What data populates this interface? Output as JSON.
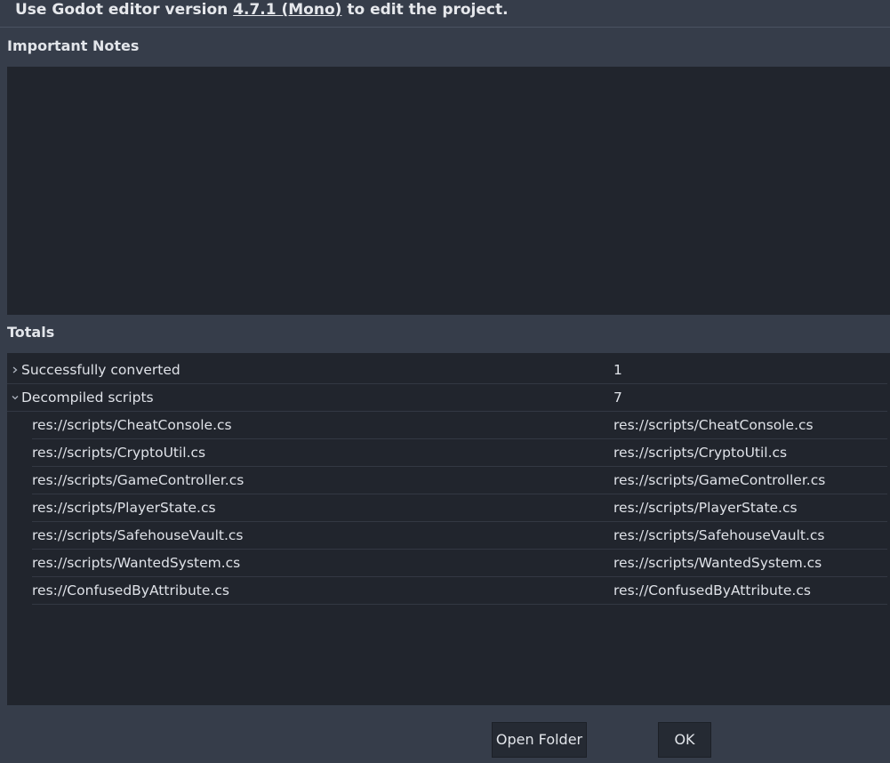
{
  "header": {
    "prefix": "Use Godot editor version ",
    "version": "4.7.1 (Mono)",
    "suffix": " to edit the project."
  },
  "notes": {
    "title": "Important Notes"
  },
  "totals": {
    "title": "Totals",
    "groups": [
      {
        "name": "Successfully converted",
        "value": "1",
        "expanded": false
      },
      {
        "name": "Decompiled scripts",
        "value": "7",
        "expanded": true
      }
    ],
    "scripts": [
      {
        "name": "res://scripts/CheatConsole.cs",
        "value": "res://scripts/CheatConsole.cs"
      },
      {
        "name": "res://scripts/CryptoUtil.cs",
        "value": "res://scripts/CryptoUtil.cs"
      },
      {
        "name": "res://scripts/GameController.cs",
        "value": "res://scripts/GameController.cs"
      },
      {
        "name": "res://scripts/PlayerState.cs",
        "value": "res://scripts/PlayerState.cs"
      },
      {
        "name": "res://scripts/SafehouseVault.cs",
        "value": "res://scripts/SafehouseVault.cs"
      },
      {
        "name": "res://scripts/WantedSystem.cs",
        "value": "res://scripts/WantedSystem.cs"
      },
      {
        "name": "res://ConfusedByAttribute.cs",
        "value": "res://ConfusedByAttribute.cs"
      }
    ]
  },
  "buttons": {
    "open_folder": "Open Folder",
    "ok": "OK"
  }
}
